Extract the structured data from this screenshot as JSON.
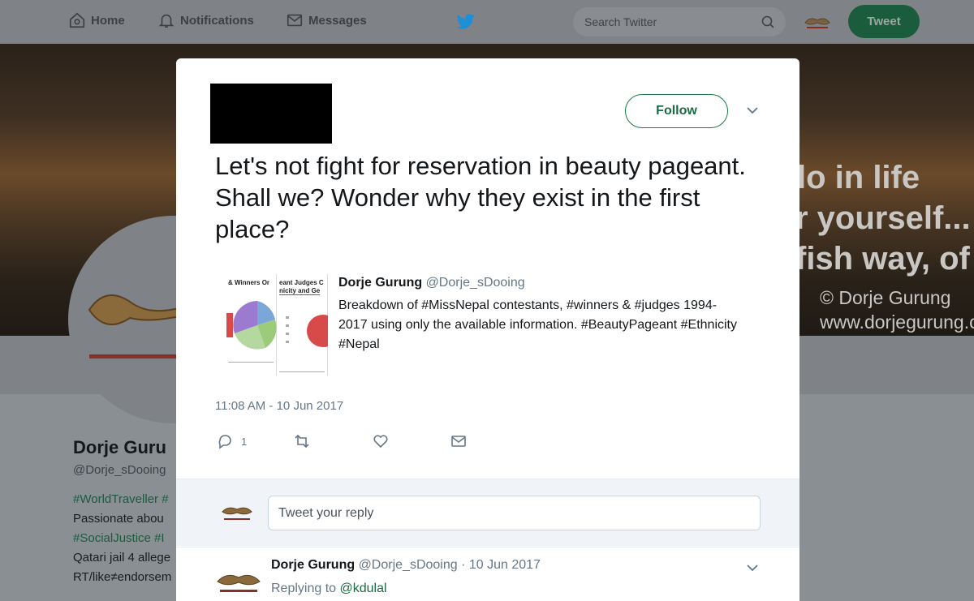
{
  "nav": {
    "home": "Home",
    "notifications": "Notifications",
    "messages": "Messages",
    "search_placeholder": "Search Twitter",
    "tweet_button": "Tweet"
  },
  "banner": {
    "lines": [
      "lo in life",
      "r yourself...",
      "fish way, of co"
    ],
    "credit": [
      "© Dorje Gurung",
      "www.dorjegurung.c"
    ]
  },
  "profile": {
    "name": "Dorje Guru",
    "handle": "@Dorje_sDooing",
    "bio_lines": [
      {
        "tag": "#WorldTraveller #",
        "text": ""
      },
      {
        "tag": "",
        "text": "Passionate abou"
      },
      {
        "tag": "#SocialJustice #I",
        "text": ""
      },
      {
        "tag": "",
        "text": "Qatari jail 4 allege"
      },
      {
        "tag": "",
        "text": "RT/like≠endorsem"
      }
    ]
  },
  "modal": {
    "follow_button": "Follow",
    "tweet_text": "Let's not fight for reservation in beauty pageant. Shall we? Wonder why they exist in the first place?",
    "quoted": {
      "name": "Dorje Gurung",
      "handle": "@Dorje_sDooing",
      "text": "Breakdown of #MissNepal contestants, #winners & #judges 1994-2017 using only the available information. #BeautyPageant #Ethnicity #Nepal",
      "thumb_titles": [
        "& Winners Or",
        "eant Judges C",
        "nicity and Ge"
      ]
    },
    "timestamp": "11:08 AM - 10 Jun 2017",
    "actions": {
      "reply_count": "1",
      "retweet_count": "",
      "like_count": "",
      "message_count": ""
    },
    "reply_placeholder": "Tweet your reply",
    "reply_tweet": {
      "name": "Dorje Gurung",
      "handle": "@Dorje_sDooing",
      "date": "· 10 Jun 2017",
      "replying_prefix": "Replying to",
      "replying_to": "@kdulal"
    }
  },
  "colors": {
    "accent": "#1a6b41",
    "nav_bg": "#7f8286",
    "tweet_button_bg": "#1a5c3c"
  }
}
